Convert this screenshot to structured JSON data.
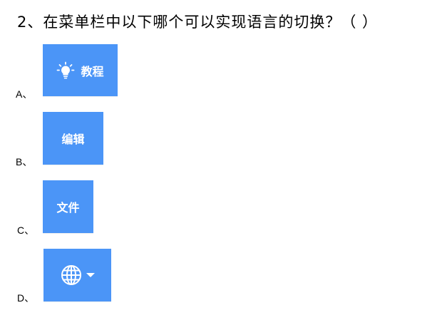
{
  "question": {
    "text": "2、在菜单栏中以下哪个可以实现语言的切换？（  ）"
  },
  "options": [
    {
      "label": "A、",
      "button_text": "教程",
      "icon": "lightbulb-icon"
    },
    {
      "label": "B、",
      "button_text": "编辑",
      "icon": ""
    },
    {
      "label": "C、",
      "button_text": "文件",
      "icon": ""
    },
    {
      "label": "D、",
      "button_text": "",
      "icon": "globe-icon"
    }
  ],
  "colors": {
    "button_bg": "#4b95f7",
    "button_text": "#ffffff"
  }
}
